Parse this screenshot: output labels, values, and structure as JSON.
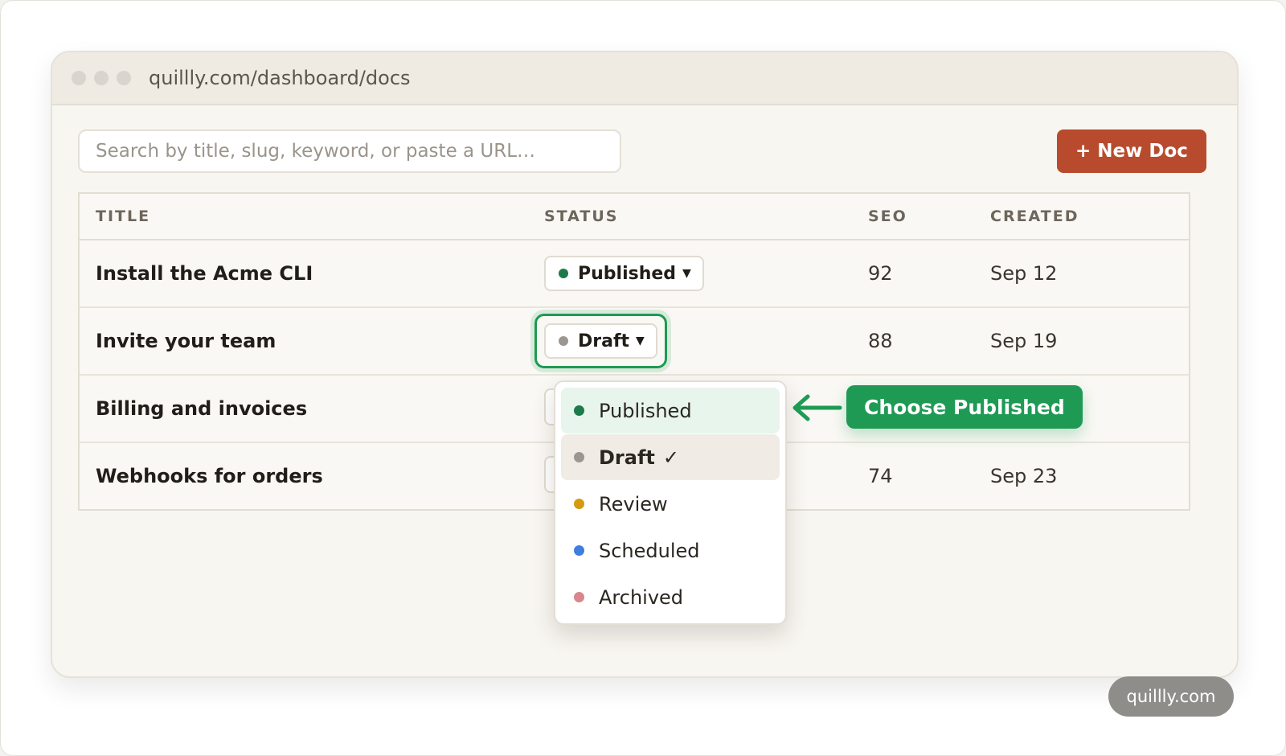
{
  "browser": {
    "url": "quillly.com/dashboard/docs"
  },
  "toolbar": {
    "search_placeholder": "Search by title, slug, keyword, or paste a URL…",
    "new_doc_label": "+ New Doc"
  },
  "table": {
    "headers": {
      "title": "TITLE",
      "status": "STATUS",
      "seo": "SEO",
      "created": "CREATED"
    },
    "rows": [
      {
        "title": "Install the Acme CLI",
        "status": "Published",
        "seo": "92",
        "created": "Sep 12"
      },
      {
        "title": "Invite your team",
        "status": "Draft",
        "seo": "88",
        "created": "Sep 19"
      },
      {
        "title": "Billing and invoices",
        "status": "",
        "seo": "",
        "created": ""
      },
      {
        "title": "Webhooks for orders",
        "status": "",
        "seo": "74",
        "created": "Sep 23"
      }
    ]
  },
  "status_dropdown": {
    "options": [
      {
        "label": "Published",
        "color": "#1e7a4a",
        "state": "hover"
      },
      {
        "label": "Draft",
        "color": "#9a9690",
        "state": "selected",
        "check": "✓"
      },
      {
        "label": "Review",
        "color": "#d39a12"
      },
      {
        "label": "Scheduled",
        "color": "#3f7de0"
      },
      {
        "label": "Archived",
        "color": "#d9868c"
      }
    ]
  },
  "callout": {
    "label": "Choose Published"
  },
  "watermark": {
    "label": "quillly.com"
  },
  "colors": {
    "accent": "#b84b2d",
    "highlight": "#1e9a55",
    "published": "#1e7a4a",
    "draft": "#9a9690"
  }
}
